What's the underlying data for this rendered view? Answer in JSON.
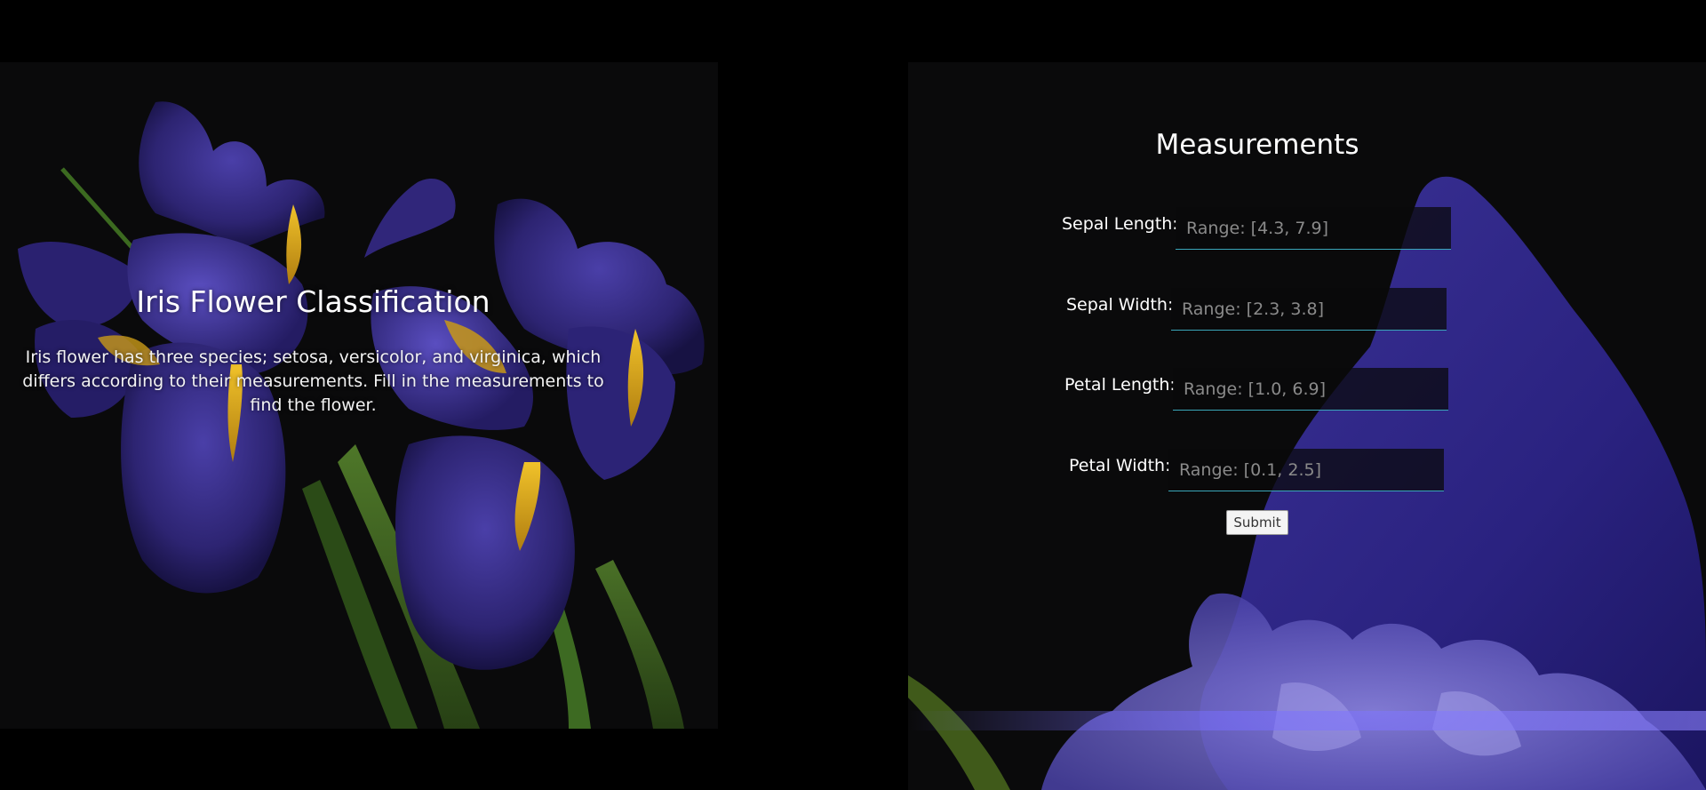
{
  "intro": {
    "title": "Iris Flower Classification",
    "description": "Iris flower has three species; setosa, versicolor, and virginica, which differs according to their measurements. Fill in the measurements to find the flower."
  },
  "form": {
    "title": "Measurements",
    "fields": [
      {
        "label": "Sepal Length:",
        "placeholder": "Range: [4.3, 7.9]",
        "value": ""
      },
      {
        "label": "Sepal Width:",
        "placeholder": "Range: [2.3, 3.8]",
        "value": ""
      },
      {
        "label": "Petal Length:",
        "placeholder": "Range: [1.0, 6.9]",
        "value": ""
      },
      {
        "label": "Petal Width:",
        "placeholder": "Range: [0.1, 2.5]",
        "value": ""
      }
    ],
    "submit_label": "Submit"
  },
  "colors": {
    "background": "#0a0a0b",
    "petal": "#3a2f8f",
    "petal_light": "#6c60c9",
    "accent_yellow": "#d9a919",
    "stem": "#4f7a2a",
    "input_underline": "#3aa6b9"
  }
}
